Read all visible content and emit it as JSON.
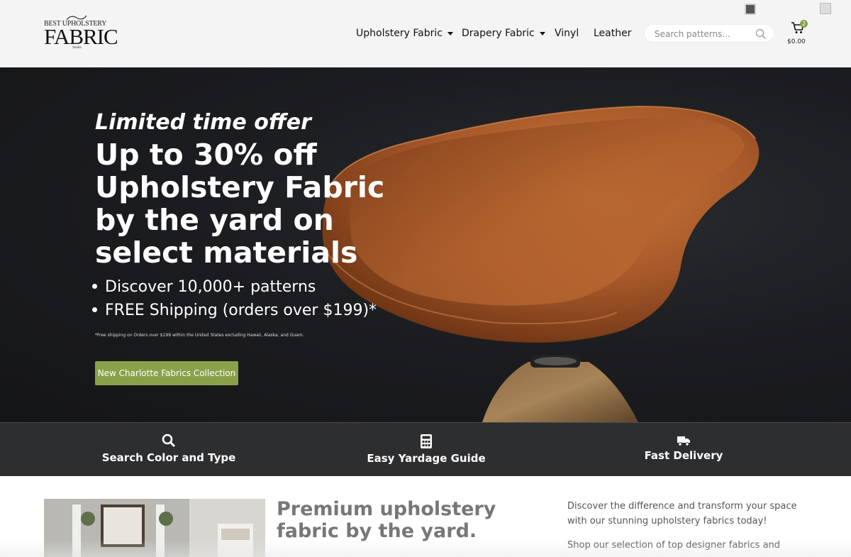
{
  "header": {
    "logo": {
      "line1": "BEST UPHOLSTERY",
      "line2": "FABRIC",
      "line3": "Studio"
    },
    "nav": [
      {
        "label": "Upholstery Fabric",
        "has_dropdown": true
      },
      {
        "label": "Drapery Fabric",
        "has_dropdown": true
      },
      {
        "label": "Vinyl",
        "has_dropdown": false
      },
      {
        "label": "Leather",
        "has_dropdown": false
      }
    ],
    "search": {
      "placeholder": "Search patterns...",
      "icon": "search-icon"
    },
    "cart": {
      "count": "2",
      "total": "$0.00",
      "icon": "cart-icon"
    }
  },
  "hero": {
    "offer": "Limited time offer",
    "headline": "Up to 30% off Upholstery Fabric by the yard on select materials",
    "bullets": [
      "Discover 10,000+ patterns",
      "FREE Shipping (orders over $199)*"
    ],
    "fine_print": "*Free shipping on Orders over $199 within the United States excluding Hawaii, Alaska, and Guam.",
    "cta_label": "New Charlotte Fabrics Collection"
  },
  "features": [
    {
      "label": "Search Color and Type",
      "icon": "search-icon"
    },
    {
      "label": "Easy Yardage Guide",
      "icon": "calculator-icon"
    },
    {
      "label": "Fast Delivery",
      "icon": "truck-icon"
    }
  ],
  "intro": {
    "heading": "Premium upholstery fabric by the yard.",
    "paragraph1": "Discover the difference and transform your space with our stunning upholstery fabrics today!",
    "paragraph2": "Shop our selection of top designer fabrics and"
  },
  "colors": {
    "accent": "#8aa14a",
    "hero_bg": "#1c1d20",
    "feature_bar": "#2d2e30",
    "chair": "#b5652d"
  }
}
